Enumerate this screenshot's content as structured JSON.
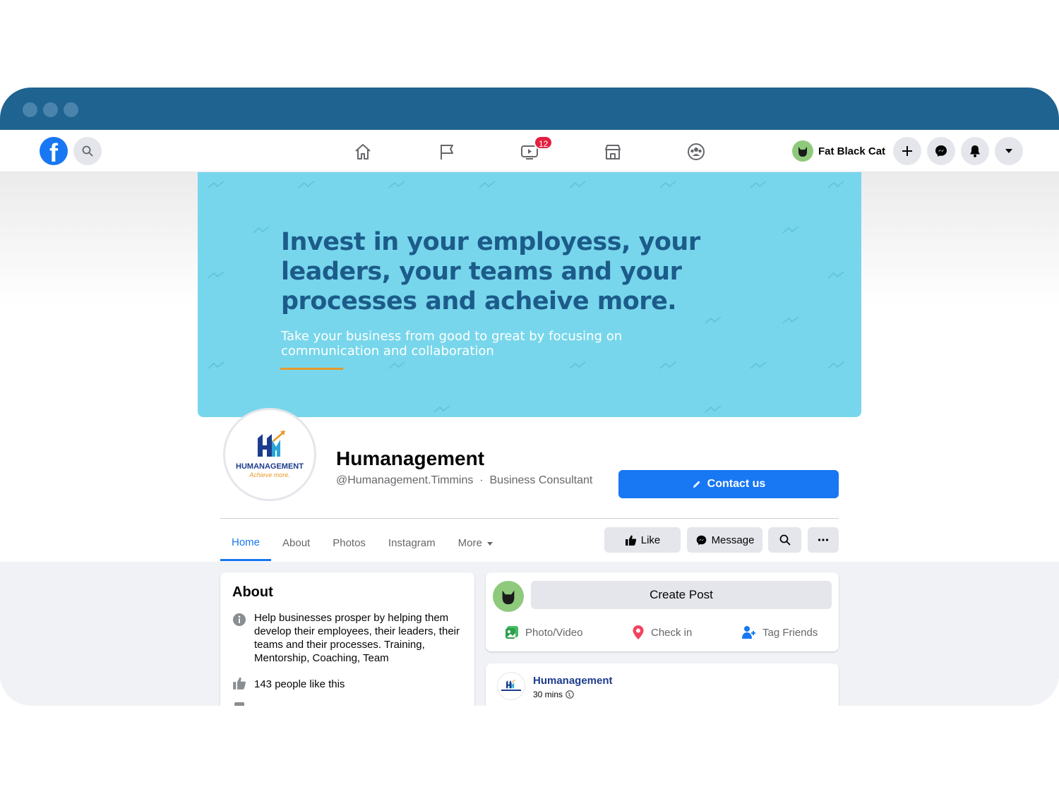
{
  "colors": {
    "titlebar": "#1f6390",
    "brand_blue": "#1877f2",
    "cover_bg": "#77d6eb",
    "cover_heading": "#1c5b8a",
    "accent_orange": "#e8992a",
    "badge_red": "#e41e3f"
  },
  "navbar": {
    "logo_letter": "f",
    "watch_badge": "12",
    "user_name": "Fat Black Cat",
    "nav_icons": [
      "home-icon",
      "flag-icon",
      "watch-icon",
      "marketplace-icon",
      "groups-icon"
    ],
    "right_icons": [
      "plus-icon",
      "messenger-icon",
      "bell-icon",
      "caret-down-icon"
    ]
  },
  "cover": {
    "headline": "Invest in your employess, your leaders, your teams and your processes and acheive more.",
    "subline": "Take your business from good to great by focusing on communication and collaboration"
  },
  "profile": {
    "logo_monogram": "HM",
    "logo_name": "HUMANAGEMENT",
    "logo_tagline": "Achieve more.",
    "page_name": "Humanagement",
    "handle": "@Humanagement.Timmins",
    "category": "Business Consultant",
    "contact_label": "Contact us"
  },
  "tabs": {
    "home": "Home",
    "about": "About",
    "photos": "Photos",
    "instagram": "Instagram",
    "more": "More"
  },
  "actions": {
    "like": "Like",
    "message": "Message"
  },
  "about_card": {
    "title": "About",
    "description": "Help businesses prosper by helping them develop their employees, their leaders, their teams and their processes. Training, Mentorship, Coaching, Team",
    "likes": "143 people like this"
  },
  "create_post": {
    "button": "Create Post",
    "photo_video": "Photo/Video",
    "check_in": "Check in",
    "tag_friends": "Tag Friends"
  },
  "post": {
    "author": "Humanagement",
    "time": "30 mins"
  }
}
